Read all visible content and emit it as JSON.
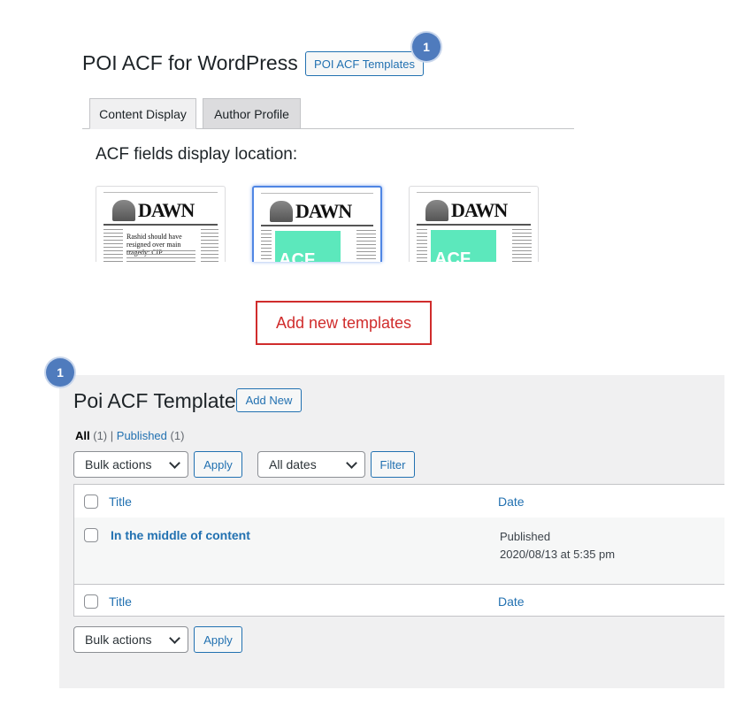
{
  "header": {
    "title": "POI ACF for WordPress",
    "templates_button": "POI ACF Templates",
    "badge": "1"
  },
  "tabs": [
    {
      "label": "Content Display",
      "active": true
    },
    {
      "label": "Author Profile",
      "active": false
    }
  ],
  "display_location": {
    "label": "ACF fields display location:",
    "thumbnails": [
      {
        "paper": "DAWN",
        "headline": "Rashid should have resigned over main tragedy: CIP",
        "selected": false
      },
      {
        "paper": "DAWN",
        "block": "ACF",
        "selected": true
      },
      {
        "paper": "DAWN",
        "block": "ACF",
        "selected": false
      }
    ]
  },
  "callout": "Add new templates",
  "list": {
    "badge": "1",
    "title": "Poi ACF Template",
    "add_new": "Add New",
    "filters": {
      "all_label": "All",
      "all_count": "(1)",
      "separator": "|",
      "published_label": "Published",
      "published_count": "(1)"
    },
    "bulk_actions": "Bulk actions",
    "apply": "Apply",
    "dates": "All dates",
    "filter": "Filter",
    "columns": {
      "title": "Title",
      "date": "Date"
    },
    "rows": [
      {
        "title": "In the middle of content",
        "status": "Published",
        "date": "2020/08/13 at 5:35 pm"
      }
    ]
  },
  "colors": {
    "accent": "#2271b1",
    "callout": "#d02c2c",
    "badge": "#4f7bbd",
    "acf_block": "#5ce8bc"
  }
}
